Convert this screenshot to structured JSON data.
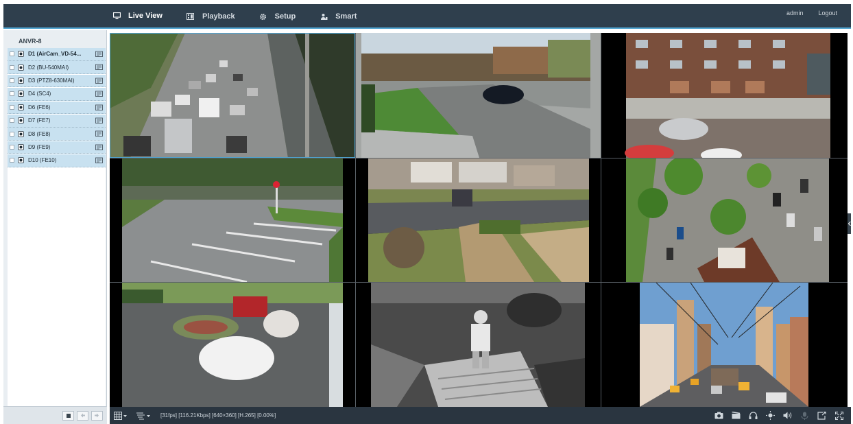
{
  "nav": {
    "items": [
      {
        "label": "Live View",
        "icon": "monitor-icon"
      },
      {
        "label": "Playback",
        "icon": "film-icon"
      },
      {
        "label": "Setup",
        "icon": "gear-icon"
      },
      {
        "label": "Smart",
        "icon": "person-icon"
      }
    ],
    "user": "admin",
    "logout": "Logout"
  },
  "sidebar": {
    "root": "ANVR-8",
    "devices": [
      {
        "label": "D1 (AirCam_VD-54..."
      },
      {
        "label": "D2 (BU-540MAI)"
      },
      {
        "label": "D3 (PTZ8-630MAI)"
      },
      {
        "label": "D4 (SC4)"
      },
      {
        "label": "D6 (FE6)"
      },
      {
        "label": "D7 (FE7)"
      },
      {
        "label": "D8 (FE8)"
      },
      {
        "label": "D9 (FE9)"
      },
      {
        "label": "D10 (FE10)"
      }
    ]
  },
  "bottombar": {
    "stats": "[31fps] [116.21Kbps] [640×360] [H.265] [0.00%]"
  },
  "colors": {
    "topbar": "#2f3f4d",
    "accent": "#4fa3cf",
    "selected_row": "#c8e1f0",
    "bottombar": "#2a3540"
  }
}
